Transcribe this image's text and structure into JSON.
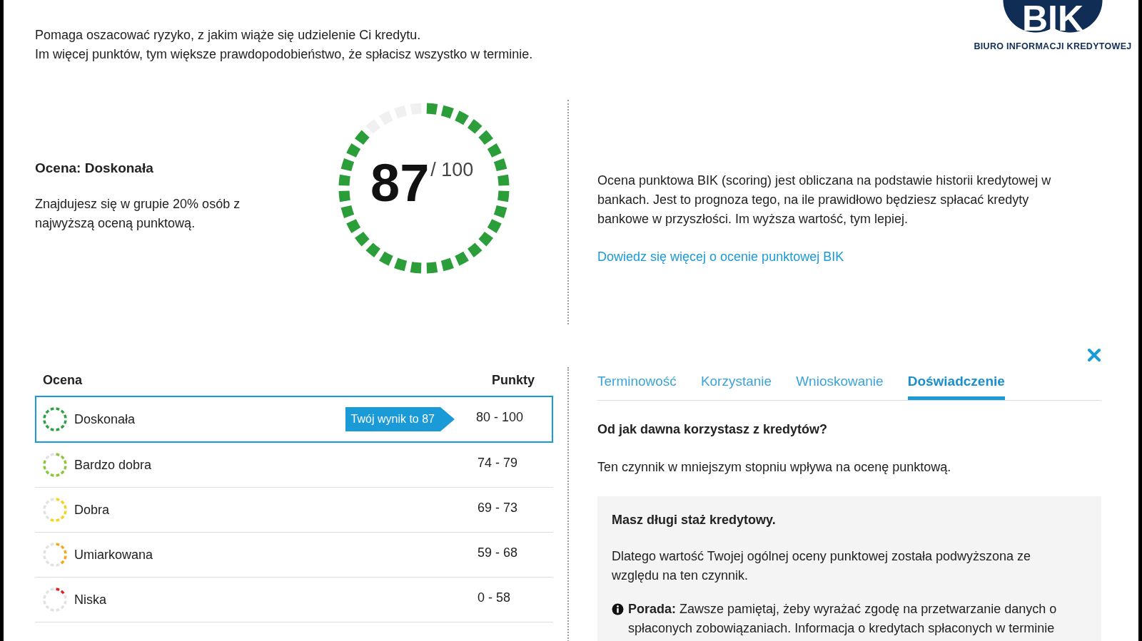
{
  "intro": [
    "Pomaga oszacować ryzyko, z jakim wiąże się udzielenie Ci kredytu.",
    "Im więcej punktów, tym większe prawdopodobieństwo, że spłacisz wszystko w terminie."
  ],
  "logo": {
    "text": "BIK",
    "caption": "BIURO INFORMACJI KREDYTOWEJ"
  },
  "rating": {
    "title": "Ocena: Doskonała",
    "description": "Znajdujesz się w grupie 20% osób z najwyższą oceną punktową."
  },
  "gauge": {
    "score": "87",
    "max": "/ 100",
    "level": 0.87
  },
  "info": {
    "text": "Ocena punktowa BIK (scoring) jest obliczana na podstawie historii kredytowej w bankach. Jest to prognoza tego, na ile prawidłowo będziesz spłacać kredyty bankowe w przyszłości. Im wyższa wartość, tym lepiej.",
    "link": "Dowiedz się więcej o ocenie punktowej BIK"
  },
  "table": {
    "columns": [
      "Ocena",
      "Punkty"
    ],
    "rows": [
      {
        "label": "Doskonała",
        "points": "80 - 100",
        "color": "#2ea043",
        "selected": true,
        "badge": "Twój wynik to 87"
      },
      {
        "label": "Bardzo dobra",
        "points": "74 - 79",
        "color": "#8cc63f",
        "selected": false
      },
      {
        "label": "Dobra",
        "points": "69 - 73",
        "color": "#f5d31a",
        "selected": false
      },
      {
        "label": "Umiarkowana",
        "points": "59 - 68",
        "color": "#f2a91f",
        "selected": false
      },
      {
        "label": "Niska",
        "points": "0 - 58",
        "color": "#e02020",
        "selected": false
      }
    ]
  },
  "tabs": [
    {
      "label": "Terminowość",
      "selected": false
    },
    {
      "label": "Korzystanie",
      "selected": false
    },
    {
      "label": "Wnioskowanie",
      "selected": false
    },
    {
      "label": "Doświadczenie",
      "selected": true
    }
  ],
  "factor": {
    "question": "Od jak dawna korzystasz z kredytów?",
    "impact": "Ten czynnik w mniejszym stopniu wpływa na ocenę punktową.",
    "box": {
      "title": "Masz długi staż kredytowy.",
      "text": "Dlatego wartość Twojej ogólnej oceny punktowej została podwyższona ze względu na ten czynnik.",
      "tip": "**Porada:**  Zawsze pamiętaj, żeby wyrażać zgodę na przetwarzanie danych o spłaconych zobowiązaniach. Informacja o kredytach spłaconych w terminie"
    }
  }
}
